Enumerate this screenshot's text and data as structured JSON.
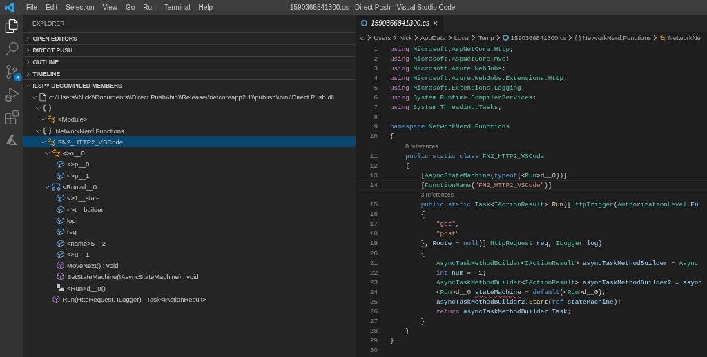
{
  "window": {
    "title": "1590366841300.cs - Direct Push - Visual Studio Code"
  },
  "menu": [
    "File",
    "Edit",
    "Selection",
    "View",
    "Go",
    "Run",
    "Terminal",
    "Help"
  ],
  "activity_bar": [
    {
      "kind": "files",
      "selected": true
    },
    {
      "kind": "search",
      "selected": false
    },
    {
      "kind": "source-control",
      "selected": false,
      "badge": "8"
    },
    {
      "kind": "run",
      "selected": false
    },
    {
      "kind": "extensions",
      "selected": false
    },
    {
      "kind": "azure",
      "selected": false
    }
  ],
  "sidebar": {
    "title": "EXPLORER",
    "sections": [
      {
        "label": "OPEN EDITORS",
        "expanded": false
      },
      {
        "label": "DIRECT PUSH",
        "expanded": false
      },
      {
        "label": "OUTLINE",
        "expanded": false
      },
      {
        "label": "TIMELINE",
        "expanded": false
      },
      {
        "label": "ILSPY DECOMPILED MEMBERS",
        "expanded": true
      }
    ],
    "tree": [
      {
        "label": "c:\\\\Users\\\\Nick\\\\Documents\\\\Direct Push\\\\bin\\\\Release\\\\netcoreapp2.1\\\\publish\\\\bin\\\\Direct Push.dll",
        "kind": "file",
        "expanded": true,
        "selected": false,
        "children": [
          {
            "kind": "namespace",
            "expanded": true,
            "selected": false,
            "children": [
              {
                "label": "<Module>",
                "kind": "class",
                "expanded": true,
                "selected": false
              }
            ]
          },
          {
            "label": "NetworkNerd.Functions",
            "kind": "namespace",
            "expanded": true,
            "selected": false,
            "children": [
              {
                "label": "FN2_HTTP2_VSCode",
                "kind": "class",
                "expanded": true,
                "selected": true,
                "children": [
                  {
                    "label": "<>o__0",
                    "kind": "class",
                    "expanded": true,
                    "selected": false,
                    "children": [
                      {
                        "label": "<>p__0",
                        "kind": "field",
                        "selected": false
                      },
                      {
                        "label": "<>p__1",
                        "kind": "field",
                        "selected": false
                      }
                    ]
                  },
                  {
                    "label": "<Run>d__0",
                    "kind": "struct",
                    "expanded": true,
                    "selected": false,
                    "children": [
                      {
                        "label": "<>1__state",
                        "kind": "field",
                        "selected": false
                      },
                      {
                        "label": "<>t__builder",
                        "kind": "field",
                        "selected": false
                      },
                      {
                        "label": "log",
                        "kind": "field",
                        "selected": false
                      },
                      {
                        "label": "req",
                        "kind": "field",
                        "selected": false
                      },
                      {
                        "label": "<name>5__2",
                        "kind": "field",
                        "selected": false
                      },
                      {
                        "label": "<>u__1",
                        "kind": "field",
                        "selected": false
                      },
                      {
                        "label": "MoveNext() : void",
                        "kind": "method",
                        "selected": false
                      },
                      {
                        "label": "SetStateMachine(IAsyncStateMachine) : void",
                        "kind": "method",
                        "selected": false
                      },
                      {
                        "label": "<Run>d__0()",
                        "kind": "ctor",
                        "selected": false
                      }
                    ]
                  },
                  {
                    "label": "Run(HttpRequest, ILogger) : Task<IActionResult>",
                    "kind": "method",
                    "selected": false
                  }
                ]
              }
            ]
          }
        ]
      }
    ]
  },
  "editor": {
    "tabs": [
      {
        "label": "1590366841300.cs",
        "close": "×",
        "selected": true,
        "preview": true
      }
    ],
    "breadcrumbs": [
      {
        "label": "c:",
        "kind": "text"
      },
      {
        "label": "Users",
        "kind": "text"
      },
      {
        "label": "Nick",
        "kind": "text"
      },
      {
        "label": "AppData",
        "kind": "text"
      },
      {
        "label": "Local",
        "kind": "text"
      },
      {
        "label": "Temp",
        "kind": "text"
      },
      {
        "label": "1590366841300.cs",
        "kind": "file"
      },
      {
        "label": "{ } NetworkNerd.Functions",
        "kind": "text"
      },
      {
        "label": "NetworkNe",
        "kind": "class"
      }
    ],
    "lines": [
      {
        "kind": "code",
        "number": "1",
        "tokens": [
          {
            "kind": "ctl",
            "text": "using"
          },
          {
            "kind": "type",
            "text": " Microsoft.AspNetCore.Http"
          },
          {
            "kind": "plain",
            "text": ";"
          }
        ]
      },
      {
        "kind": "code",
        "number": "2",
        "tokens": [
          {
            "kind": "ctl",
            "text": "using"
          },
          {
            "kind": "type",
            "text": " Microsoft.AspNetCore.Mvc"
          },
          {
            "kind": "plain",
            "text": ";"
          }
        ]
      },
      {
        "kind": "code",
        "number": "3",
        "tokens": [
          {
            "kind": "ctl",
            "text": "using"
          },
          {
            "kind": "type",
            "text": " Microsoft.Azure.WebJobs"
          },
          {
            "kind": "plain",
            "text": ";"
          }
        ]
      },
      {
        "kind": "code",
        "number": "4",
        "tokens": [
          {
            "kind": "ctl",
            "text": "using"
          },
          {
            "kind": "type",
            "text": " Microsoft.Azure.WebJobs.Extensions.Http"
          },
          {
            "kind": "plain",
            "text": ";"
          }
        ]
      },
      {
        "kind": "code",
        "number": "5",
        "tokens": [
          {
            "kind": "ctl",
            "text": "using"
          },
          {
            "kind": "type",
            "text": " Microsoft.Extensions.Logging"
          },
          {
            "kind": "plain",
            "text": ";"
          }
        ]
      },
      {
        "kind": "code",
        "number": "6",
        "tokens": [
          {
            "kind": "ctl",
            "text": "using"
          },
          {
            "kind": "type",
            "text": " System.Runtime.CompilerServices"
          },
          {
            "kind": "plain",
            "text": ";"
          }
        ]
      },
      {
        "kind": "code",
        "number": "7",
        "tokens": [
          {
            "kind": "ctl",
            "text": "using"
          },
          {
            "kind": "type",
            "text": " System.Threading.Tasks"
          },
          {
            "kind": "plain",
            "text": ";"
          }
        ]
      },
      {
        "kind": "code",
        "number": "8"
      },
      {
        "kind": "code",
        "number": "9",
        "tokens": [
          {
            "kind": "kw",
            "text": "namespace"
          },
          {
            "kind": "type",
            "text": " NetworkNerd.Functions"
          }
        ]
      },
      {
        "kind": "code",
        "number": "10",
        "tokens": [
          {
            "kind": "plain",
            "text": "{"
          }
        ]
      },
      {
        "kind": "lens",
        "text": "0 references"
      },
      {
        "kind": "code",
        "number": "11",
        "tokens": [
          {
            "kind": "kw",
            "text": "    public static class"
          },
          {
            "kind": "type",
            "text": " FN2_HTTP2_VSCode"
          }
        ]
      },
      {
        "kind": "code",
        "number": "12",
        "tokens": [
          {
            "kind": "plain",
            "text": "    {"
          }
        ]
      },
      {
        "kind": "code",
        "number": "13",
        "tokens": [
          {
            "kind": "plain",
            "text": "        ["
          },
          {
            "kind": "type",
            "text": "AsyncStateMachine"
          },
          {
            "kind": "plain",
            "text": "("
          },
          {
            "kind": "kw",
            "text": "typeof"
          },
          {
            "kind": "plain",
            "text": "(<"
          },
          {
            "kind": "type",
            "text": "Run"
          },
          {
            "kind": "plain",
            "text": ">d__0))]"
          }
        ]
      },
      {
        "kind": "code",
        "number": "14",
        "current": true,
        "tokens": [
          {
            "kind": "plain",
            "text": "        ["
          },
          {
            "kind": "type",
            "text": "FunctionName"
          },
          {
            "kind": "plain",
            "text": "("
          },
          {
            "kind": "str",
            "text": "\"FN2_HTTP2_VSCode\""
          },
          {
            "kind": "plain",
            "text": ")]"
          }
        ]
      },
      {
        "kind": "lens",
        "text": "3 references"
      },
      {
        "kind": "code",
        "number": "15",
        "tokens": [
          {
            "kind": "kw",
            "text": "        public static"
          },
          {
            "kind": "type",
            "text": " Task"
          },
          {
            "kind": "plain",
            "text": "<"
          },
          {
            "kind": "type",
            "text": "IActionResult"
          },
          {
            "kind": "plain",
            "text": "> "
          },
          {
            "kind": "fn",
            "text": "Run"
          },
          {
            "kind": "plain",
            "text": "(["
          },
          {
            "kind": "type",
            "text": "HttpTrigger"
          },
          {
            "kind": "plain",
            "text": "("
          },
          {
            "kind": "type",
            "text": "AuthorizationLevel"
          },
          {
            "kind": "plain",
            "text": "."
          },
          {
            "kind": "var",
            "text": "Fu"
          }
        ]
      },
      {
        "kind": "code",
        "number": "16",
        "tokens": [
          {
            "kind": "plain",
            "text": "        {"
          }
        ]
      },
      {
        "kind": "code",
        "number": "17",
        "tokens": [
          {
            "kind": "str",
            "text": "            \"get\""
          },
          {
            "kind": "plain",
            "text": ","
          }
        ]
      },
      {
        "kind": "code",
        "number": "18",
        "tokens": [
          {
            "kind": "str",
            "text": "            \"post\""
          }
        ]
      },
      {
        "kind": "code",
        "number": "19",
        "tokens": [
          {
            "kind": "plain",
            "text": "        }, "
          },
          {
            "kind": "var",
            "text": "Route"
          },
          {
            "kind": "plain",
            "text": " = "
          },
          {
            "kind": "kw",
            "text": "null"
          },
          {
            "kind": "plain",
            "text": ")] "
          },
          {
            "kind": "type",
            "text": "HttpRequest"
          },
          {
            "kind": "var",
            "text": " req"
          },
          {
            "kind": "plain",
            "text": ", "
          },
          {
            "kind": "type",
            "text": "ILogger"
          },
          {
            "kind": "var",
            "text": " log"
          },
          {
            "kind": "plain",
            "text": ")"
          }
        ]
      },
      {
        "kind": "code",
        "number": "20",
        "tokens": [
          {
            "kind": "plain",
            "text": "        {"
          }
        ]
      },
      {
        "kind": "code",
        "number": "21",
        "tokens": [
          {
            "kind": "type",
            "text": "            AsyncTaskMethodBuilder"
          },
          {
            "kind": "plain",
            "text": "<"
          },
          {
            "kind": "type",
            "text": "IActionResult"
          },
          {
            "kind": "plain",
            "text": "> "
          },
          {
            "kind": "var",
            "text": "asyncTaskMethodBuilder"
          },
          {
            "kind": "plain",
            "text": " = "
          },
          {
            "kind": "type",
            "text": "Async"
          }
        ]
      },
      {
        "kind": "code",
        "number": "22",
        "tokens": [
          {
            "kind": "kw",
            "text": "            int"
          },
          {
            "kind": "var",
            "text": " num"
          },
          {
            "kind": "plain",
            "text": " = -1;"
          }
        ]
      },
      {
        "kind": "code",
        "number": "23",
        "tokens": [
          {
            "kind": "type",
            "text": "            AsyncTaskMethodBuilder"
          },
          {
            "kind": "plain",
            "text": "<"
          },
          {
            "kind": "type",
            "text": "IActionResult"
          },
          {
            "kind": "plain",
            "text": "> "
          },
          {
            "kind": "var",
            "text": "asyncTaskMethodBuilder2"
          },
          {
            "kind": "plain",
            "text": " = "
          },
          {
            "kind": "var",
            "text": "async"
          }
        ]
      },
      {
        "kind": "code",
        "number": "24",
        "tokens": [
          {
            "kind": "plain",
            "text": "            <"
          },
          {
            "kind": "type",
            "text": "Run"
          },
          {
            "kind": "plain",
            "text": ">d__0 "
          },
          {
            "kind": "err",
            "text": "stateMachine"
          },
          {
            "kind": "plain",
            "text": " = "
          },
          {
            "kind": "kw",
            "text": "default"
          },
          {
            "kind": "plain",
            "text": "(<"
          },
          {
            "kind": "type",
            "text": "Run"
          },
          {
            "kind": "plain",
            "text": ">d__0);"
          }
        ]
      },
      {
        "kind": "code",
        "number": "25",
        "tokens": [
          {
            "kind": "var",
            "text": "            asyncTaskMethodBuilder2"
          },
          {
            "kind": "plain",
            "text": "."
          },
          {
            "kind": "fn",
            "text": "Start"
          },
          {
            "kind": "plain",
            "text": "("
          },
          {
            "kind": "kw",
            "text": "ref"
          },
          {
            "kind": "var",
            "text": " stateMachine"
          },
          {
            "kind": "plain",
            "text": ");"
          }
        ]
      },
      {
        "kind": "code",
        "number": "26",
        "tokens": [
          {
            "kind": "ctl",
            "text": "            return"
          },
          {
            "kind": "var",
            "text": " asyncTaskMethodBuilder"
          },
          {
            "kind": "plain",
            "text": "."
          },
          {
            "kind": "var",
            "text": "Task"
          },
          {
            "kind": "plain",
            "text": ";"
          }
        ]
      },
      {
        "kind": "code",
        "number": "27",
        "tokens": [
          {
            "kind": "plain",
            "text": "        }"
          }
        ]
      },
      {
        "kind": "code",
        "number": "28",
        "tokens": [
          {
            "kind": "plain",
            "text": "    }"
          }
        ]
      },
      {
        "kind": "code",
        "number": "29",
        "tokens": [
          {
            "kind": "plain",
            "text": "}"
          }
        ]
      },
      {
        "kind": "code",
        "number": "30"
      }
    ]
  }
}
